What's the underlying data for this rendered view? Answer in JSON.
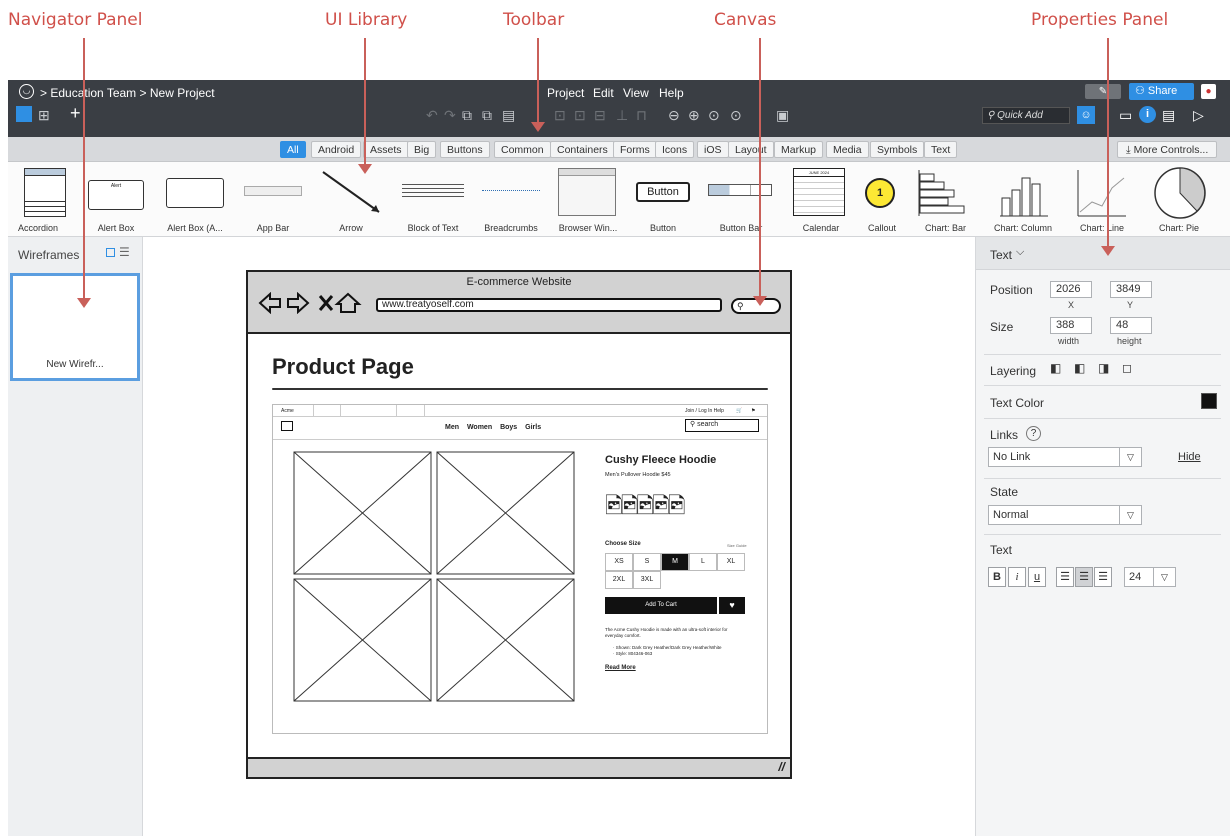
{
  "annotations": {
    "navigator": "Navigator Panel",
    "library": "UI Library",
    "toolbar": "Toolbar",
    "canvas": "Canvas",
    "properties": "Properties Panel"
  },
  "header": {
    "breadcrumb": "> Education Team > New Project",
    "menus": [
      "Project",
      "Edit",
      "View",
      "Help"
    ],
    "share": "Share",
    "quick_add": "Quick Add"
  },
  "library": {
    "tabs": [
      "All",
      "Android",
      "Assets",
      "Big",
      "Buttons",
      "Common",
      "Containers",
      "Forms",
      "Icons",
      "iOS",
      "Layout",
      "Markup",
      "Media",
      "Symbols",
      "Text"
    ],
    "more_controls": "More Controls...",
    "items": [
      "Accordion",
      "Alert Box",
      "Alert Box (A...",
      "App Bar",
      "Arrow",
      "Block of Text",
      "Breadcrumbs",
      "Browser Win...",
      "Button",
      "Button Bar",
      "Calendar",
      "Callout",
      "Chart: Bar",
      "Chart: Column",
      "Chart: Line",
      "Chart: Pie"
    ],
    "button_text": "Button",
    "callout_text": "1",
    "alert_title": "Alert",
    "calendar_month": "JUNE 2024"
  },
  "navigator": {
    "title": "Wireframes",
    "thumb_label": "New Wirefr..."
  },
  "canvas": {
    "window_title": "E-commerce Website",
    "url": "www.treatyoself.com",
    "page_title": "Product Page",
    "site": {
      "nav": [
        "Men",
        "Women",
        "Boys",
        "Girls"
      ],
      "search": "search",
      "product_name": "Cushy Fleece Hoodie",
      "subtitle": "Men's Pullover Hoodie   $45",
      "choose_size": "Choose Size",
      "size_guide": "Size Guide",
      "sizes": [
        "XS",
        "S",
        "M",
        "L",
        "XL",
        "2XL",
        "3XL"
      ],
      "selected_size": "M",
      "add_to_cart": "Add To Cart",
      "description": "The Acme Cushy Hoodie is made with an ultra-soft interior for everyday comfort.",
      "bullets": [
        "Shown: Dark Grey Heather/Dark Grey Heather/White",
        "Style: 804346-063"
      ],
      "read_more": "Read More",
      "tab_first": "Acme",
      "top_links": "Join / Log In   Help"
    }
  },
  "properties": {
    "header": "Text",
    "position_label": "Position",
    "x": "2026",
    "y": "3849",
    "x_lbl": "X",
    "y_lbl": "Y",
    "size_label": "Size",
    "width": "388",
    "height": "48",
    "w_lbl": "width",
    "h_lbl": "height",
    "layering": "Layering",
    "text_color": "Text Color",
    "links": "Links",
    "link_value": "No Link",
    "hide": "Hide",
    "state": "State",
    "state_value": "Normal",
    "text_section": "Text",
    "bold": "B",
    "italic": "i",
    "underline": "u",
    "font_size": "24"
  },
  "colors": {
    "accent": "#2f8fe3",
    "annotation": "#d0504a",
    "topbar": "#3a3e44"
  }
}
